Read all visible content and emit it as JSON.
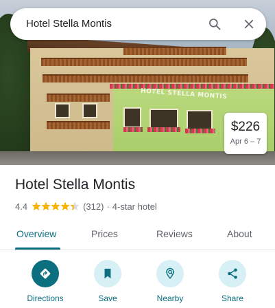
{
  "search": {
    "query": "Hotel Stella Montis",
    "search_icon": "search-icon",
    "close_icon": "close-icon"
  },
  "photo": {
    "sign_text": "HOTEL STELLA MONTIS"
  },
  "price_chip": {
    "amount": "$226",
    "dates": "Apr 6 – 7"
  },
  "place": {
    "name": "Hotel Stella Montis",
    "rating": "4.4",
    "stars": 4.4,
    "reviews": "(312)",
    "separator": "·",
    "category": "4-star hotel",
    "star_color": "#f6b400"
  },
  "tabs": [
    {
      "label": "Overview",
      "active": true
    },
    {
      "label": "Prices",
      "active": false
    },
    {
      "label": "Reviews",
      "active": false
    },
    {
      "label": "About",
      "active": false
    }
  ],
  "actions": [
    {
      "label": "Directions",
      "icon": "directions-icon"
    },
    {
      "label": "Save",
      "icon": "bookmark-icon"
    },
    {
      "label": "Nearby",
      "icon": "nearby-icon"
    },
    {
      "label": "Share",
      "icon": "share-icon"
    }
  ],
  "colors": {
    "accent": "#0b6f80",
    "accent_light": "#d7f0f5",
    "text": "#202124",
    "muted": "#5f6368"
  }
}
